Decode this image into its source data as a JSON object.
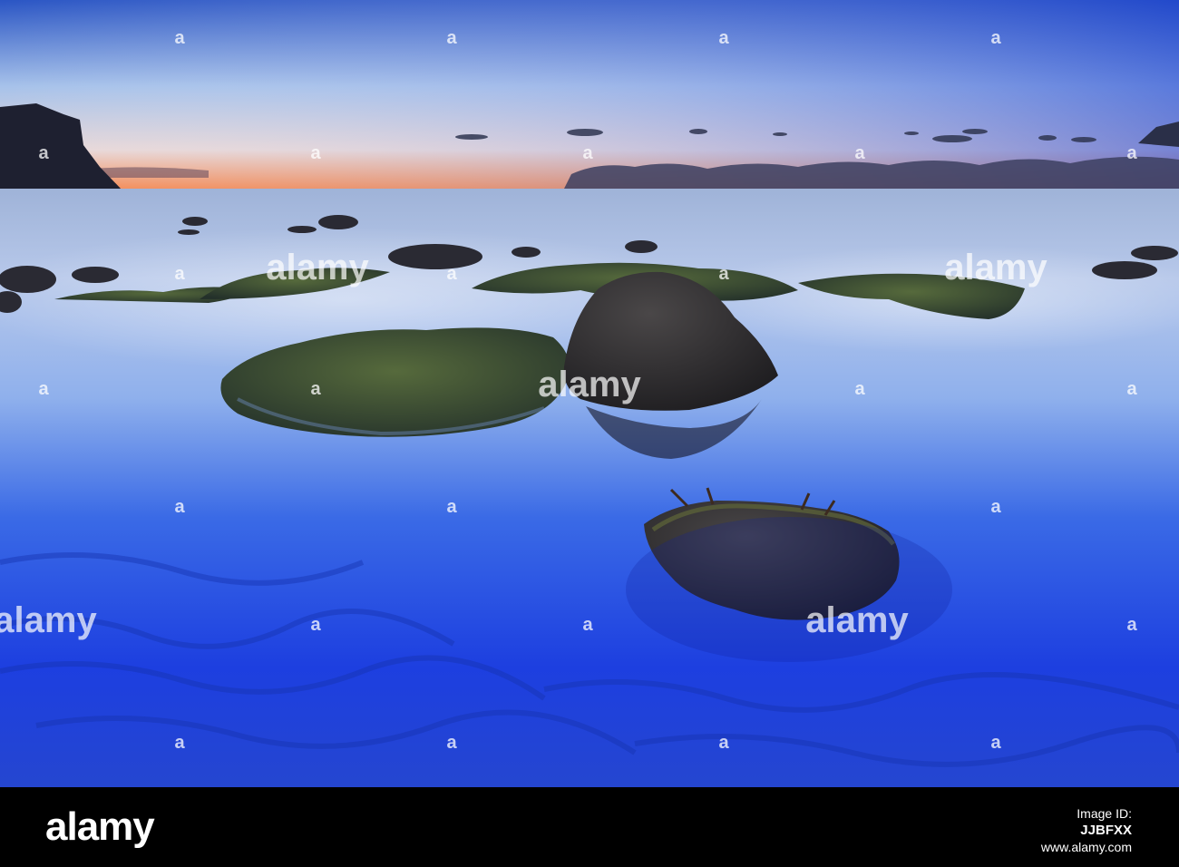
{
  "footer": {
    "brand": "alamy",
    "image_id_label": "Image ID:",
    "image_id": "JJBFXX",
    "site": "www.alamy.com"
  },
  "watermark": {
    "text": "alamy",
    "icon": "alamy-a-icon"
  },
  "colors": {
    "sky_top": "#1b3fb0",
    "sky_mid": "#8fb0e4",
    "horizon_glow": "#f07a3e",
    "water_far": "#aac0e8",
    "water_near": "#1a35d8",
    "rock": "#2b2a2c",
    "moss": "#3a5230",
    "footer_bg": "#000000"
  }
}
